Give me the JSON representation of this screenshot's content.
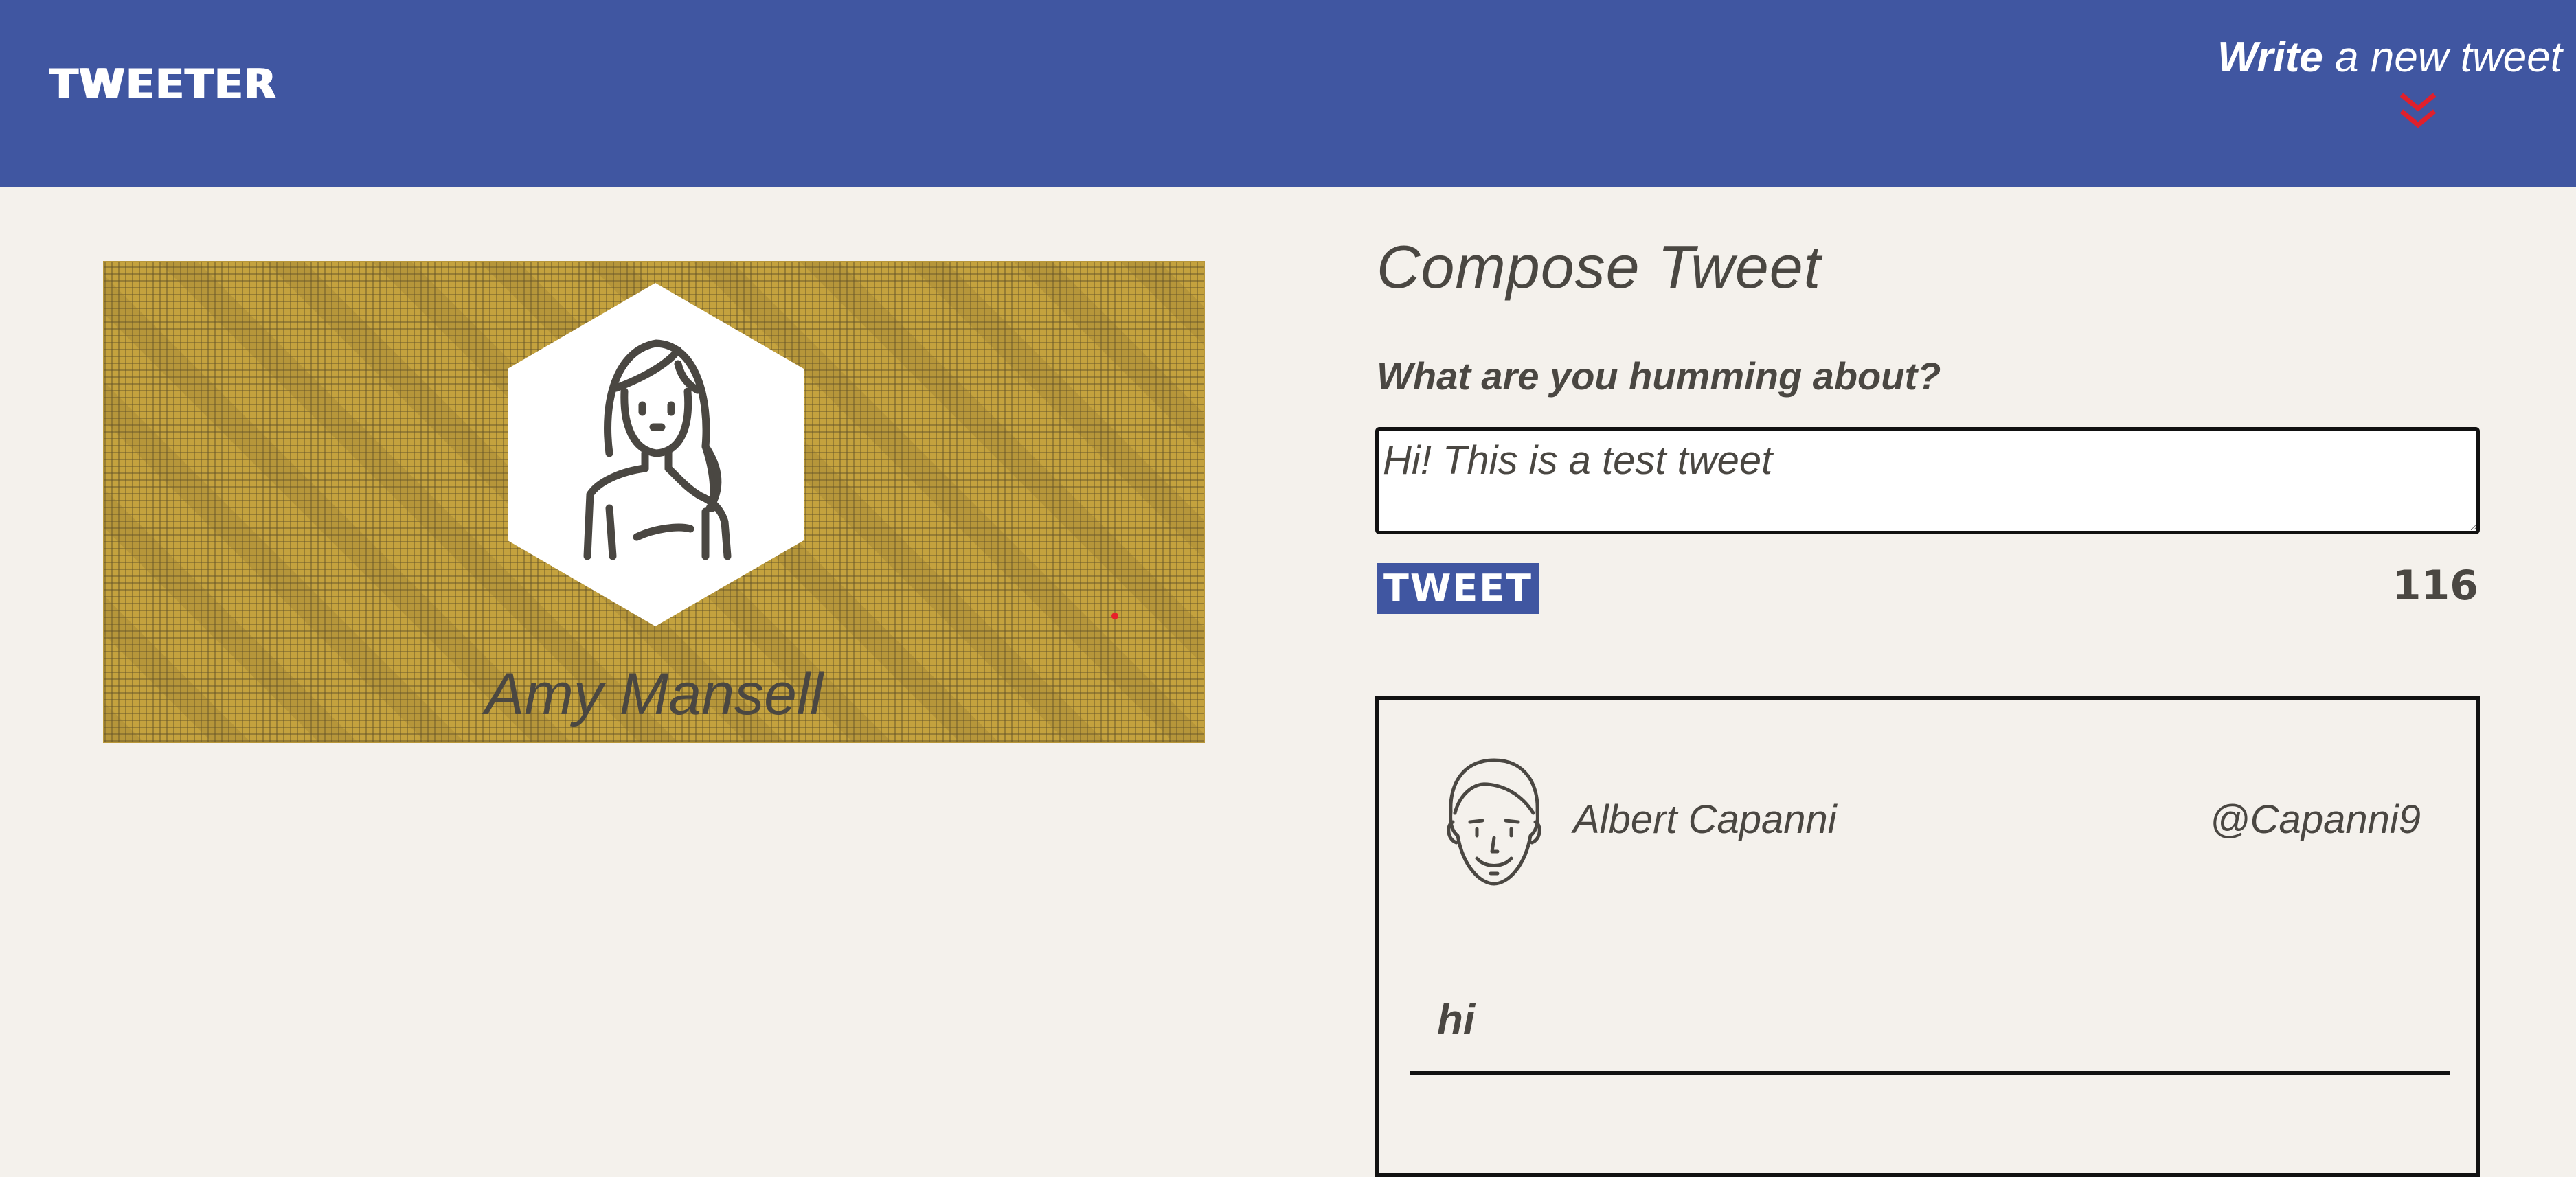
{
  "navbar": {
    "brand": "TWEETER",
    "compose_toggle_strong": "Write",
    "compose_toggle_rest": " a new tweet",
    "compose_toggle_icon": "double-chevron-down-icon",
    "background_color": "#4056a1",
    "chevron_color": "#e0202c"
  },
  "profile": {
    "name": "Amy Mansell",
    "avatar_icon": "woman-avatar-icon",
    "background_color": "#c4a23e"
  },
  "compose": {
    "title": "Compose Tweet",
    "prompt": "What are you humming about?",
    "input_value": "Hi! This is a test tweet",
    "tweet_button": "TWEET",
    "char_counter": "116"
  },
  "tweets": [
    {
      "author": "Albert Capanni",
      "handle": "@Capanni9",
      "avatar_icon": "man-avatar-icon",
      "content": "hi"
    }
  ]
}
